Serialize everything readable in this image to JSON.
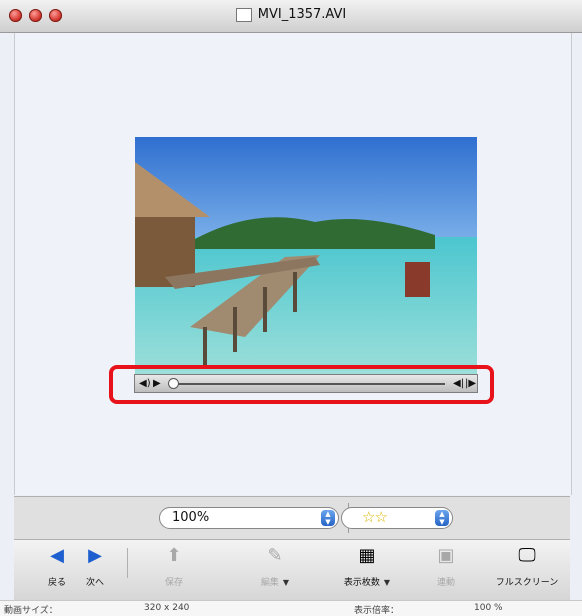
{
  "window": {
    "title": "MVI_1357.AVI"
  },
  "player": {
    "controls": [
      "volume-icon",
      "play-icon",
      "step-back-icon",
      "step-forward-icon"
    ]
  },
  "selectors": {
    "zoom_value": "100%",
    "rating_value": "☆☆"
  },
  "toolbar": {
    "back": "戻る",
    "next": "次へ",
    "save": "保存",
    "edit": "編集",
    "display_count": "表示枚数",
    "sync": "連動",
    "fullscreen": "フルスクリーン"
  },
  "status": {
    "video_size_label": "動画サイズ：",
    "video_size_value": "320 x 240",
    "zoom_label": "表示倍率：",
    "zoom_value": "100 %"
  },
  "colors": {
    "highlight": "#e8121a",
    "accent": "#1d5fcf"
  }
}
